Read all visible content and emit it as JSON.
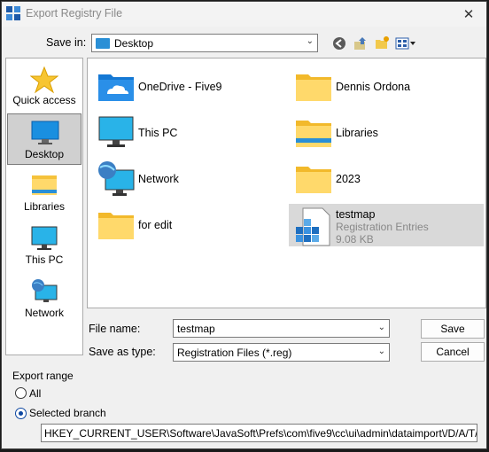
{
  "window": {
    "title": "Export Registry File"
  },
  "toolbar": {
    "save_in_label": "Save in:",
    "save_in_value": "Desktop"
  },
  "places": [
    {
      "label": "Quick access",
      "icon": "star-icon"
    },
    {
      "label": "Desktop",
      "icon": "desktop-icon"
    },
    {
      "label": "Libraries",
      "icon": "libraries-icon"
    },
    {
      "label": "This PC",
      "icon": "monitor-icon"
    },
    {
      "label": "Network",
      "icon": "network-icon"
    }
  ],
  "files": [
    {
      "name": "OneDrive - Five9",
      "icon": "onedrive-folder-icon"
    },
    {
      "name": "Dennis Ordona",
      "icon": "folder-icon"
    },
    {
      "name": "This PC",
      "icon": "monitor-icon"
    },
    {
      "name": "Libraries",
      "icon": "libraries-folder-icon"
    },
    {
      "name": "Network",
      "icon": "network-icon"
    },
    {
      "name": "2023",
      "icon": "folder-icon"
    },
    {
      "name": "for edit",
      "icon": "folder-icon"
    },
    {
      "name": "testmap",
      "type": "Registration Entries",
      "size": "9.08 KB",
      "icon": "registry-file-icon"
    }
  ],
  "form": {
    "file_name_label": "File name:",
    "file_name_value": "testmap",
    "save_as_label": "Save as type:",
    "save_as_value": "Registration Files (*.reg)",
    "save_button": "Save",
    "cancel_button": "Cancel"
  },
  "export_range": {
    "label": "Export range",
    "all_label": "All",
    "selected_label": "Selected branch",
    "selected": "Selected branch",
    "branch_path": "HKEY_CURRENT_USER\\Software\\JavaSoft\\Prefs\\com\\five9\\cc\\ui\\admin\\dataimport\\/D/A/T/A_/I."
  },
  "colors": {
    "folder": "#ffd96b",
    "accent": "#0d47a1",
    "selected_place": "#d0d0d0"
  }
}
